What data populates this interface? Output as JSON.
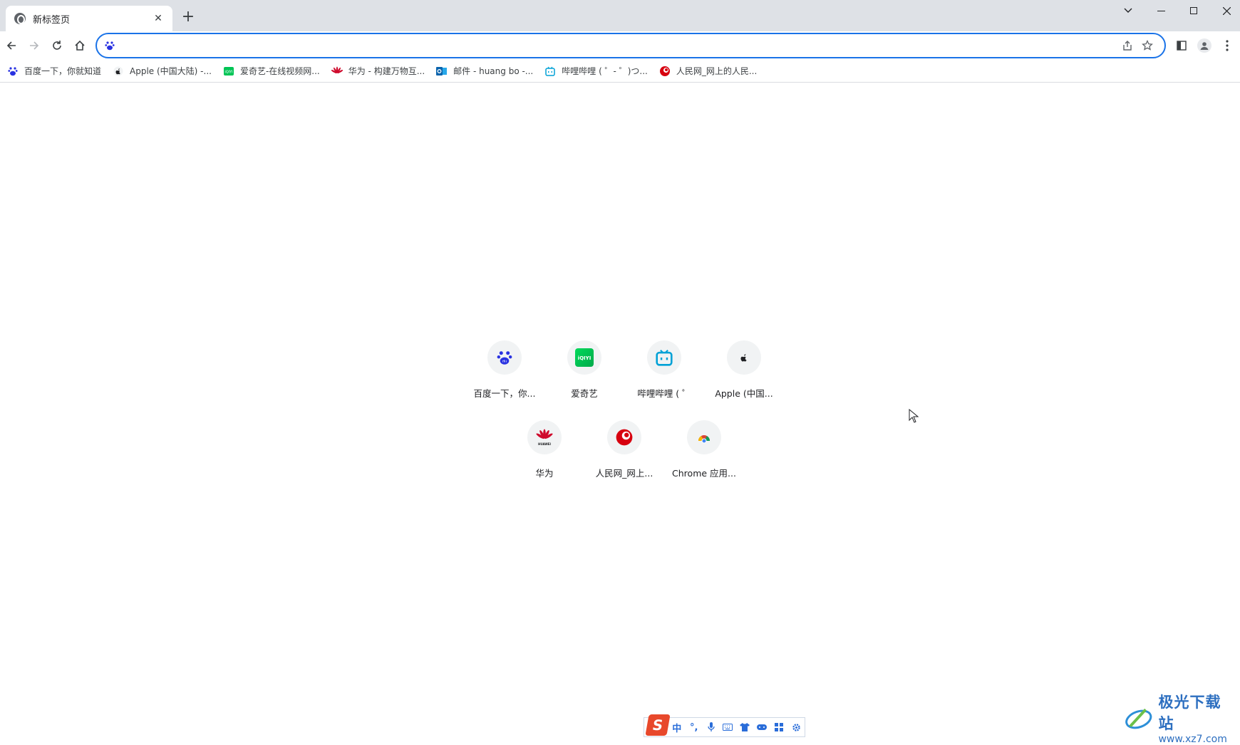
{
  "tab": {
    "title": "新标签页",
    "close": "✕"
  },
  "new_tab": "+",
  "window": {
    "chevron": "⌄"
  },
  "omnibox": {
    "value": "",
    "placeholder": ""
  },
  "bookmarks": [
    {
      "label": "百度一下，你就知道",
      "icon": "baidu-icon"
    },
    {
      "label": "Apple (中国大陆) -...",
      "icon": "apple-icon"
    },
    {
      "label": "爱奇艺-在线视频网...",
      "icon": "iqiyi-icon"
    },
    {
      "label": "华为 - 构建万物互...",
      "icon": "huawei-icon"
    },
    {
      "label": "邮件 - huang bo -...",
      "icon": "outlook-icon"
    },
    {
      "label": "哔哩哔哩 ( ゜- ゜)つ...",
      "icon": "bilibili-icon"
    },
    {
      "label": "人民网_网上的人民...",
      "icon": "people-icon"
    }
  ],
  "shortcuts": {
    "row1": [
      {
        "label": "百度一下，你...",
        "icon": "baidu-icon"
      },
      {
        "label": "爱奇艺",
        "icon": "iqiyi-icon"
      },
      {
        "label": "哔哩哔哩 ( ゜",
        "icon": "bilibili-icon"
      },
      {
        "label": "Apple (中国...",
        "icon": "apple-icon"
      }
    ],
    "row2": [
      {
        "label": "华为",
        "icon": "huawei-icon"
      },
      {
        "label": "人民网_网上...",
        "icon": "people-icon"
      },
      {
        "label": "Chrome 应用...",
        "icon": "chrome-apps-icon"
      }
    ]
  },
  "ime": {
    "logo": "S",
    "items": [
      "中",
      "°,",
      "mic",
      "keyboard",
      "shirt",
      "game",
      "apps",
      "settings"
    ]
  },
  "watermark": {
    "name": "极光下载站",
    "url": "www.xz7.com"
  },
  "colors": {
    "accent": "#1a73e8",
    "tabstrip": "#dee1e6",
    "baidu": "#2932e1",
    "huawei": "#cf0a2c",
    "bilibili": "#00a1d6"
  }
}
